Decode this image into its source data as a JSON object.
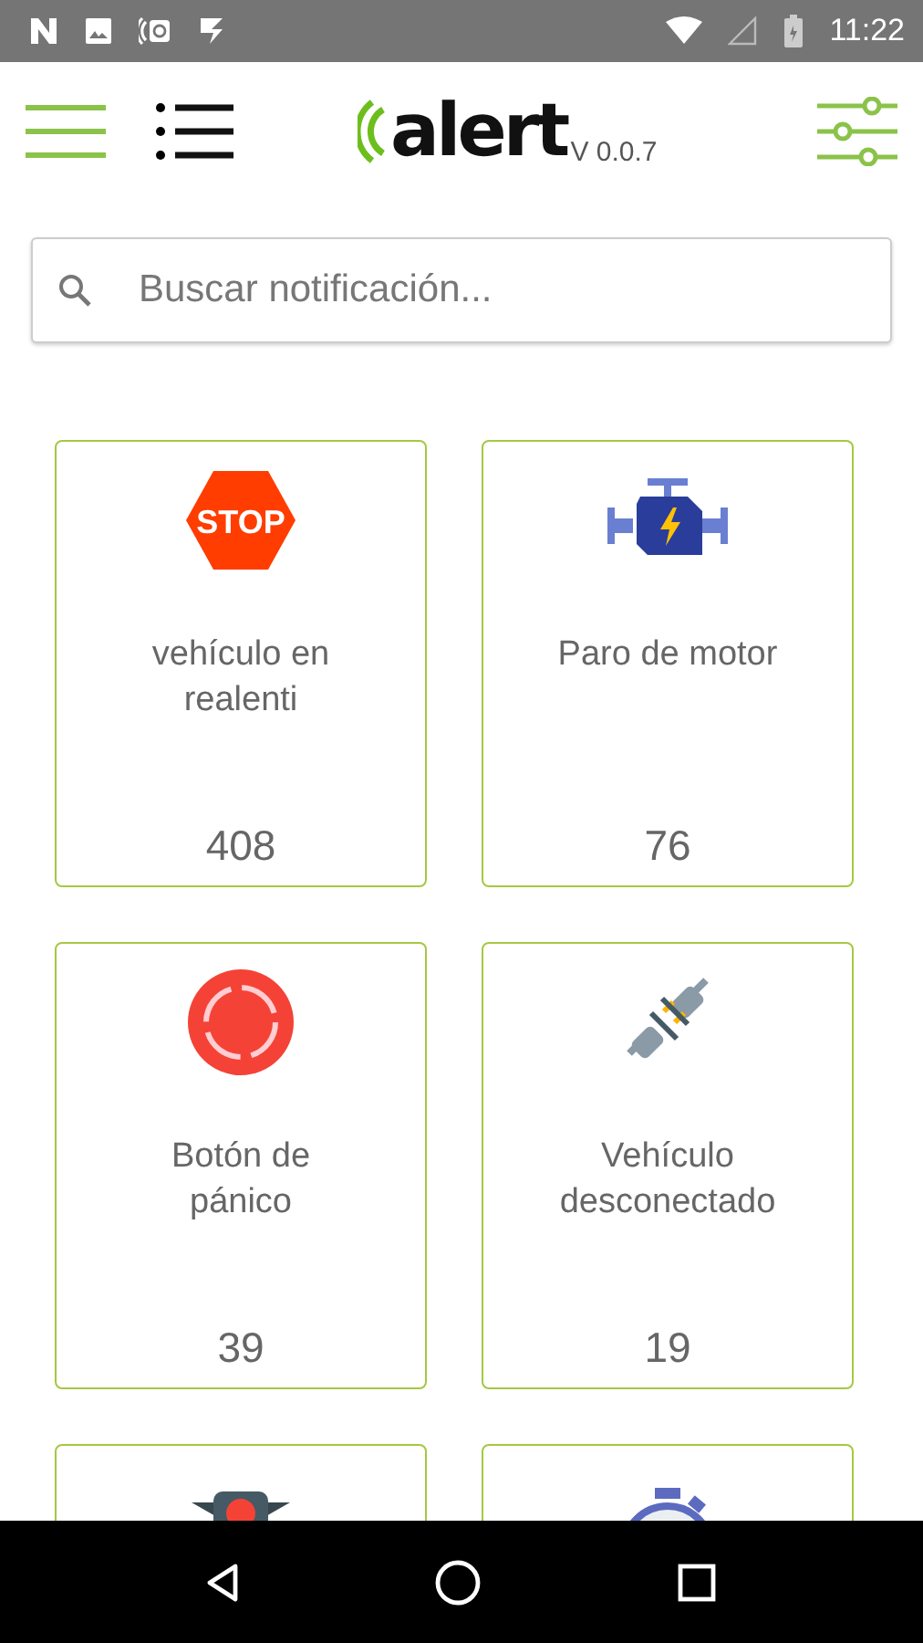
{
  "status_bar": {
    "time": "11:22"
  },
  "header": {
    "logo": "alert",
    "version": "V 0.0.7"
  },
  "search": {
    "placeholder": "Buscar notificación..."
  },
  "cards": [
    {
      "kind": "stop",
      "icon_text": "STOP",
      "label": "vehículo en realenti",
      "count": "408"
    },
    {
      "kind": "engine",
      "label": "Paro de motor",
      "count": "76"
    },
    {
      "kind": "panic",
      "label": "Botón de pánico",
      "count": "39"
    },
    {
      "kind": "plug",
      "label": "Vehículo desconectado",
      "count": "19"
    },
    {
      "kind": "traffic"
    },
    {
      "kind": "stopwatch"
    }
  ]
}
